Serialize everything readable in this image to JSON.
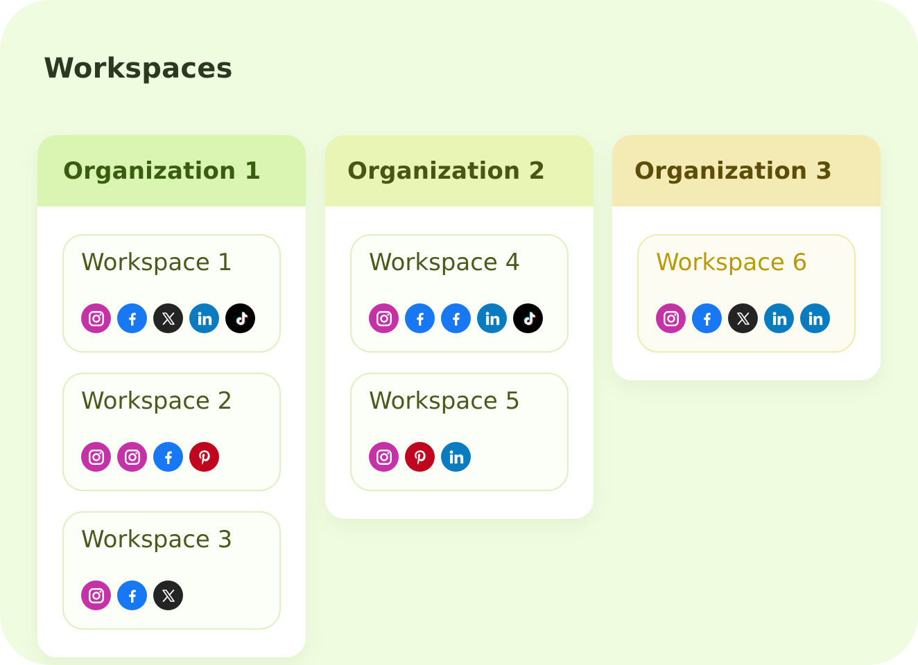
{
  "title": "Workspaces",
  "colors": {
    "page_background": "#f0fce0",
    "title_text": "#2b3a1f",
    "workspace_text": "#4a5a1c",
    "workspace_text_highlight": "#b79a06",
    "workspace_border": "#dff0c0",
    "workspace_border_highlight": "#f1eab0",
    "instagram": "#c531a7",
    "facebook": "#1877f2",
    "x": "#242424",
    "linkedin": "#0a7bbf",
    "tiktok": "#000000",
    "pinterest": "#c0061f"
  },
  "organizations": [
    {
      "name": "Organization 1",
      "header_color": "#daf4b2",
      "name_color": "#3a5c10",
      "workspaces": [
        {
          "name": "Workspace 1",
          "icons": [
            "instagram-icon",
            "facebook-icon",
            "x-icon",
            "linkedin-icon",
            "tiktok-icon"
          ]
        },
        {
          "name": "Workspace 2",
          "icons": [
            "instagram-icon",
            "instagram-icon",
            "facebook-icon",
            "pinterest-icon"
          ]
        },
        {
          "name": "Workspace 3",
          "icons": [
            "instagram-icon",
            "facebook-icon",
            "x-icon"
          ]
        }
      ]
    },
    {
      "name": "Organization 2",
      "header_color": "#e9f5b4",
      "name_color": "#485514",
      "workspaces": [
        {
          "name": "Workspace 4",
          "icons": [
            "instagram-icon",
            "facebook-icon",
            "facebook-icon",
            "linkedin-icon",
            "tiktok-icon"
          ]
        },
        {
          "name": "Workspace 5",
          "icons": [
            "instagram-icon",
            "pinterest-icon",
            "linkedin-icon"
          ]
        }
      ]
    },
    {
      "name": "Organization 3",
      "header_color": "#f4ebb4",
      "name_color": "#5c4d08",
      "workspaces": [
        {
          "name": "Workspace 6",
          "highlighted": true,
          "icons": [
            "instagram-icon",
            "facebook-icon",
            "x-icon",
            "linkedin-icon",
            "linkedin-icon"
          ]
        }
      ]
    }
  ]
}
